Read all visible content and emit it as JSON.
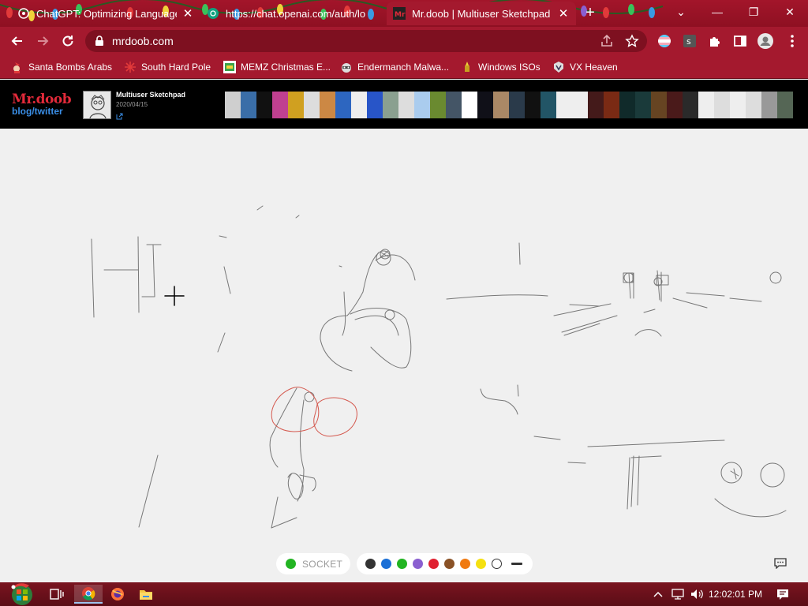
{
  "browser": {
    "tabs": [
      {
        "title": "ChatGPT: Optimizing Language",
        "active": false
      },
      {
        "title": "https://chat.openai.com/auth/lo",
        "active": false
      },
      {
        "title": "Mr.doob | Multiuser Sketchpad",
        "active": true
      }
    ],
    "url": "mrdoob.com",
    "bookmarks": [
      {
        "label": "Santa Bombs Arabs"
      },
      {
        "label": "South Hard Pole"
      },
      {
        "label": "MEMZ Christmas E..."
      },
      {
        "label": "Endermanch Malwa..."
      },
      {
        "label": "Windows ISOs"
      },
      {
        "label": "VX Heaven"
      }
    ],
    "theme_color": "#a4192e"
  },
  "site": {
    "logo_line1": "Mr.doob",
    "logo_line2": "blog/twitter",
    "project_title": "Multiuser Sketchpad",
    "project_date": "2020/04/15"
  },
  "controls": {
    "socket_label": "SOCKET",
    "socket_color": "#22b422",
    "palette": [
      "#333333",
      "#1a6fd6",
      "#22b422",
      "#8a5fd0",
      "#e02030",
      "#8a5226",
      "#f07a10",
      "#f5e010",
      "#ffffff"
    ]
  },
  "taskbar": {
    "clock": "12:02:01 PM"
  }
}
